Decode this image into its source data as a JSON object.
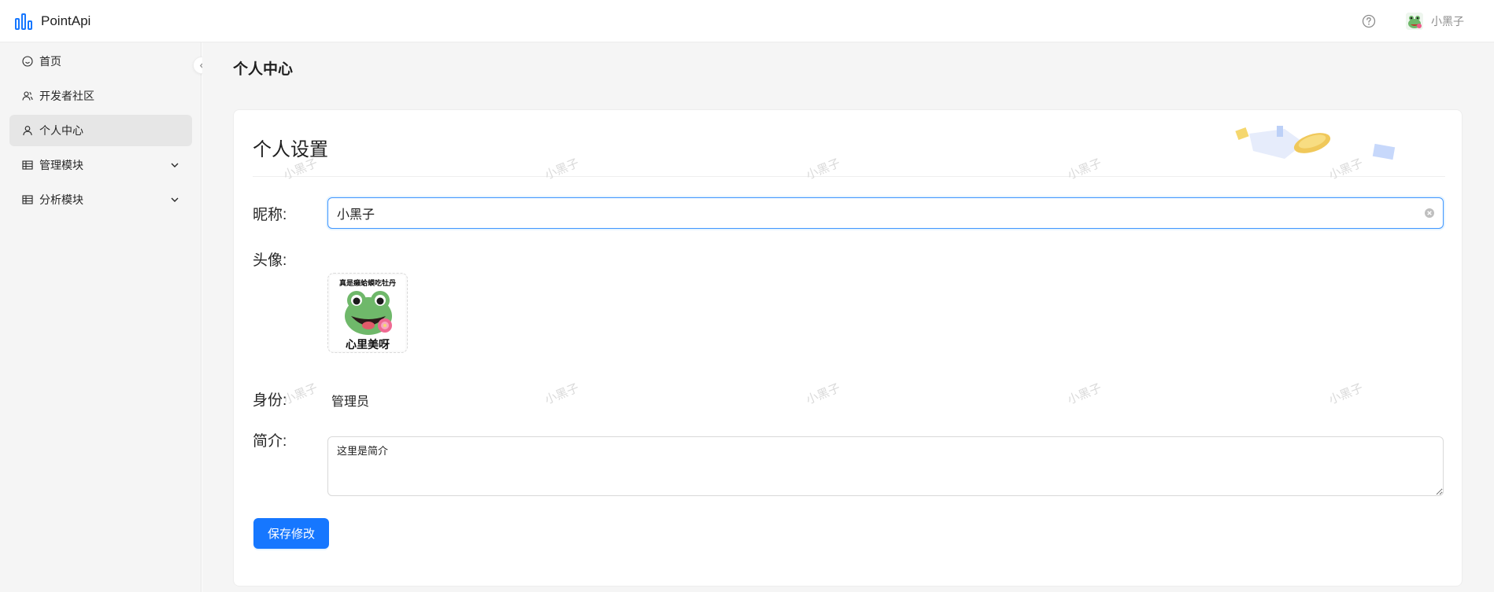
{
  "app": {
    "name": "PointApi"
  },
  "header": {
    "user_name": "小黑子"
  },
  "sidebar": {
    "items": [
      {
        "label": "首页",
        "icon": "smile-icon",
        "active": false,
        "expandable": false
      },
      {
        "label": "开发者社区",
        "icon": "users-icon",
        "active": false,
        "expandable": false
      },
      {
        "label": "个人中心",
        "icon": "user-icon",
        "active": true,
        "expandable": false
      },
      {
        "label": "管理模块",
        "icon": "table-icon",
        "active": false,
        "expandable": true
      },
      {
        "label": "分析模块",
        "icon": "table-icon",
        "active": false,
        "expandable": true
      }
    ]
  },
  "page": {
    "title": "个人中心"
  },
  "card": {
    "title": "个人设置",
    "watermark_text": "小黑子"
  },
  "form": {
    "nickname_label": "昵称:",
    "nickname_value": "小黑子",
    "avatar_label": "头像:",
    "avatar_caption_top": "真是癞蛤蟆吃牡丹",
    "avatar_caption_bottom": "心里美呀",
    "role_label": "身份:",
    "role_value": "管理员",
    "bio_label": "简介:",
    "bio_value": "这里是简介",
    "save_label": "保存修改"
  },
  "colors": {
    "primary": "#1677ff",
    "logo": "#1677ff",
    "sidebar_bg": "#f5f5f5",
    "active_item_bg": "#e6e6e6"
  }
}
